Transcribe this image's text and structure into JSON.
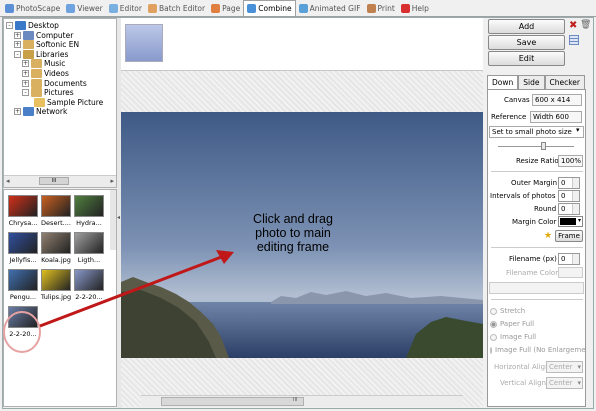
{
  "tabs": [
    {
      "label": "PhotoScape",
      "icon": "photoscape-icon",
      "color": "#5b8fd6"
    },
    {
      "label": "Viewer",
      "icon": "viewer-icon",
      "color": "#6fa3e0"
    },
    {
      "label": "Editor",
      "icon": "editor-icon",
      "color": "#7ab0e0"
    },
    {
      "label": "Batch Editor",
      "icon": "batch-editor-icon",
      "color": "#e0a060"
    },
    {
      "label": "Page",
      "icon": "page-icon",
      "color": "#e08040"
    },
    {
      "label": "Combine",
      "icon": "combine-icon",
      "color": "#4a90d9"
    },
    {
      "label": "Animated GIF",
      "icon": "animated-gif-icon",
      "color": "#5aa0d8"
    },
    {
      "label": "Print",
      "icon": "print-icon",
      "color": "#c08050"
    },
    {
      "label": "Help",
      "icon": "help-icon",
      "color": "#d83030"
    }
  ],
  "active_tab": "Combine",
  "tree": {
    "items": [
      {
        "label": "Desktop",
        "icon": "desktop-icon",
        "expander": "-"
      },
      {
        "label": "Computer",
        "icon": "computer-icon",
        "expander": "+"
      },
      {
        "label": "Softonic EN",
        "icon": "user-folder-icon",
        "expander": "+"
      },
      {
        "label": "Libraries",
        "icon": "libraries-icon",
        "expander": "-"
      },
      {
        "label": "Music",
        "icon": "music-folder-icon",
        "expander": "+"
      },
      {
        "label": "Videos",
        "icon": "videos-folder-icon",
        "expander": "+"
      },
      {
        "label": "Documents",
        "icon": "documents-folder-icon",
        "expander": "+"
      },
      {
        "label": "Pictures",
        "icon": "pictures-folder-icon",
        "expander": "-"
      },
      {
        "label": "Sample Picture",
        "icon": "folder-icon",
        "expander": ""
      },
      {
        "label": "Network",
        "icon": "network-icon",
        "expander": "+"
      }
    ],
    "scroll_thumb": "III"
  },
  "thumbnails": [
    {
      "label": "Chrysa...",
      "color": "#d03018"
    },
    {
      "label": "Desert....",
      "color": "#c86020"
    },
    {
      "label": "Hydra...",
      "color": "#508040"
    },
    {
      "label": "Jellyfis...",
      "color": "#3050a0"
    },
    {
      "label": "Koala.jpg",
      "color": "#908070"
    },
    {
      "label": "Ligth...",
      "color": "#a0a0a0"
    },
    {
      "label": "Pengu...",
      "color": "#4070b0"
    },
    {
      "label": "Tulips.jpg",
      "color": "#e0c020"
    },
    {
      "label": "2-2-20...",
      "color": "#8898c8"
    },
    {
      "label": "2-2-20...",
      "color": "#6a7ea8"
    }
  ],
  "caption": {
    "line1": "Click and drag",
    "line2": "photo to main",
    "line3": "editing frame"
  },
  "canvas_scroll": "III",
  "buttons": {
    "add": "Add",
    "save": "Save",
    "edit": "Edit"
  },
  "right_tabs": [
    "Down",
    "Side",
    "Checker"
  ],
  "panel": {
    "canvas_label": "Canvas",
    "canvas_value": "600 x 414",
    "reference_label": "Reference",
    "reference_value": "Width 600",
    "size_select": "Set to small photo size",
    "resize_label": "Resize Ratio",
    "resize_value": "100%",
    "outer_margin": "Outer Margin",
    "outer_margin_value": "0",
    "intervals": "Intervals of photos",
    "intervals_value": "0",
    "round": "Round",
    "round_value": "0",
    "margin_color": "Margin Color",
    "margin_color_value": "#000000",
    "frame_button": "Frame",
    "filename_label": "Filename (px)",
    "filename_value": "0",
    "filename_color": "Filename Color",
    "radios": [
      "Stretch",
      "Paper Full",
      "Image Full",
      "Image Full (No Enlargement)"
    ],
    "h_align_label": "Horizontal Align",
    "h_align_value": "Center",
    "v_align_label": "Vertical Align",
    "v_align_value": "Center"
  },
  "colors": {
    "arrow": "#c01818",
    "highlight_circle": "#e8a0a0"
  }
}
